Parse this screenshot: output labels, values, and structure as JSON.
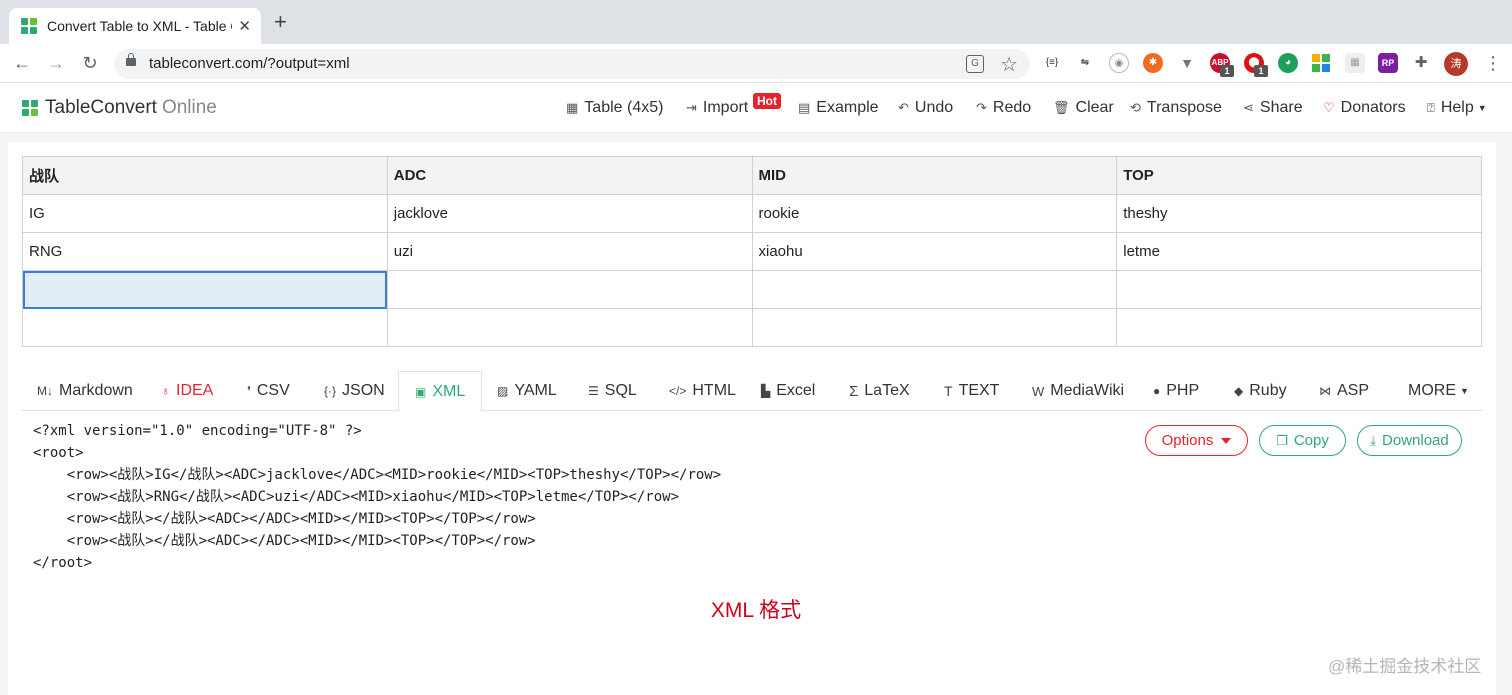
{
  "browser": {
    "tab_title": "Convert Table to XML - Table C",
    "new_tab_label": "+",
    "url": "tableconvert.com/?output=xml",
    "ext_abp_badge": "1",
    "ext_red_badge": "1",
    "avatar_label": "涛"
  },
  "header": {
    "brand_name": "TableConvert",
    "brand_suffix": "Online",
    "menu": {
      "table": "Table (4x5)",
      "import": "Import",
      "hot": "Hot",
      "example": "Example",
      "undo": "Undo",
      "redo": "Redo",
      "clear": "Clear",
      "transpose": "Transpose",
      "share": "Share",
      "donators": "Donators",
      "help": "Help"
    }
  },
  "table": {
    "headers": [
      "战队",
      "ADC",
      "MID",
      "TOP"
    ],
    "rows": [
      [
        "IG",
        "jacklove",
        "rookie",
        "theshy"
      ],
      [
        "RNG",
        "uzi",
        "xiaohu",
        "letme"
      ],
      [
        "",
        "",
        "",
        ""
      ],
      [
        "",
        "",
        "",
        ""
      ]
    ]
  },
  "format_tabs": {
    "markdown": "Markdown",
    "idea": "IDEA",
    "csv": "CSV",
    "json": "JSON",
    "xml": "XML",
    "yaml": "YAML",
    "sql": "SQL",
    "html": "HTML",
    "excel": "Excel",
    "latex": "LaTeX",
    "text": "TEXT",
    "mediawiki": "MediaWiki",
    "php": "PHP",
    "ruby": "Ruby",
    "asp": "ASP",
    "more": "MORE"
  },
  "output": {
    "lines": [
      "<?xml version=\"1.0\" encoding=\"UTF-8\" ?>",
      "<root>",
      "    <row><战队>IG</战队><ADC>jacklove</ADC><MID>rookie</MID><TOP>theshy</TOP></row>",
      "    <row><战队>RNG</战队><ADC>uzi</ADC><MID>xiaohu</MID><TOP>letme</TOP></row>",
      "    <row><战队></战队><ADC></ADC><MID></MID><TOP></TOP></row>",
      "    <row><战队></战队><ADC></ADC><MID></MID><TOP></TOP></row>",
      "</root>"
    ],
    "options_label": "Options",
    "copy_label": "Copy",
    "download_label": "Download"
  },
  "caption": "XML 格式",
  "watermark": "@稀土掘金技术社区"
}
